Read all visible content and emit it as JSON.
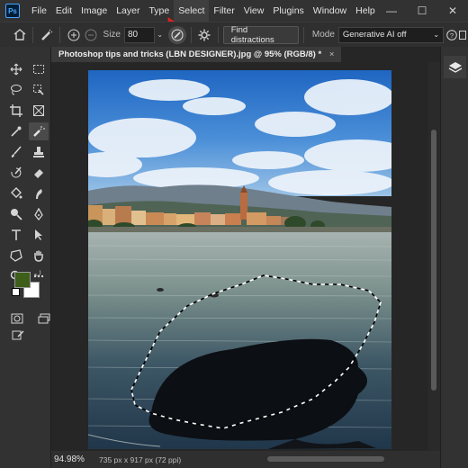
{
  "app": {
    "logo_text": "Ps"
  },
  "menu": [
    "File",
    "Edit",
    "Image",
    "Layer",
    "Type",
    "Select",
    "Filter",
    "View",
    "Plugins",
    "Window",
    "Help"
  ],
  "window_controls": {
    "minimize": "—",
    "maximize": "☐",
    "close": "✕"
  },
  "options": {
    "size_label": "Size",
    "size_value": "80",
    "find_distractions_label": "Find distractions",
    "mode_label": "Mode",
    "mode_value": "Generative AI off",
    "help_glyph": "?"
  },
  "document": {
    "tab_title": "Photoshop tips and tricks (LBN DESIGNER).jpg @ 95% (RGB/8) *",
    "close_glyph": "×"
  },
  "status": {
    "zoom": "94.98%",
    "doc_info": "735 px x 917 px (72 ppi)"
  },
  "colors": {
    "foreground": "#3e5f1a",
    "background": "#ffffff",
    "accent": "#4aa3ff"
  },
  "icons": {
    "tools": [
      "move-tool-icon",
      "marquee-tool-icon",
      "lasso-tool-icon",
      "object-select-tool-icon",
      "crop-tool-icon",
      "frame-tool-icon",
      "eyedropper-tool-icon",
      "remove-tool-icon",
      "brush-tool-icon",
      "stamp-tool-icon",
      "history-brush-tool-icon",
      "eraser-tool-icon",
      "paint-bucket-tool-icon",
      "smudge-tool-icon",
      "dodge-tool-icon",
      "pen-tool-icon",
      "type-tool-icon",
      "path-select-tool-icon",
      "custom-shape-tool-icon",
      "hand-tool-icon",
      "zoom-tool-icon"
    ]
  }
}
